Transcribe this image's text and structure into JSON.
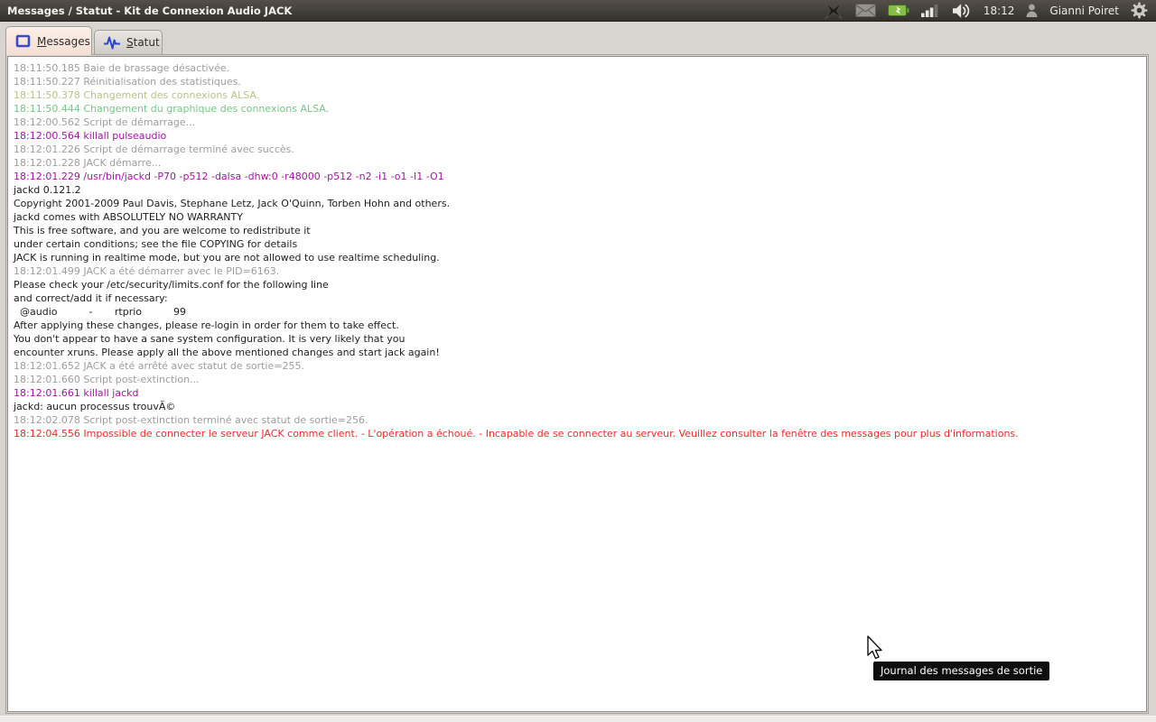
{
  "colors": {
    "gray": "#9d9d9d",
    "khaki": "#bcc088",
    "green": "#77c687",
    "magenta": "#a413a4",
    "black": "#1d1d1d",
    "red": "#ee2b2b"
  },
  "panel": {
    "title": "Messages / Statut - Kit de Connexion Audio JACK",
    "clock": "18:12",
    "user": "Gianni Poiret",
    "tray_icons": [
      "jack-tray-icon",
      "mail-icon",
      "battery-icon",
      "signal-strength-icon",
      "volume-icon",
      "user-icon",
      "settings-gear-icon"
    ]
  },
  "tabs": [
    {
      "label": "Messages"
    },
    {
      "label": "Statut"
    }
  ],
  "tooltip": {
    "text": "Journal des messages de sortie"
  },
  "log": {
    "lines": [
      {
        "color": "gray",
        "text": "18:11:50.185 Baie de brassage désactivée."
      },
      {
        "color": "gray",
        "text": "18:11:50.227 Réinitialisation des statistiques."
      },
      {
        "color": "khaki",
        "text": "18:11:50.378 Changement des connexions ALSA."
      },
      {
        "color": "green",
        "text": "18:11:50.444 Changement du graphique des connexions ALSA."
      },
      {
        "color": "gray",
        "text": "18:12:00.562 Script de démarrage..."
      },
      {
        "color": "magenta",
        "text": "18:12:00.564 killall pulseaudio"
      },
      {
        "color": "gray",
        "text": "18:12:01.226 Script de démarrage terminé avec succès."
      },
      {
        "color": "gray",
        "text": "18:12:01.228 JACK démarre..."
      },
      {
        "color": "magenta",
        "text": "18:12:01.229 /usr/bin/jackd -P70 -p512 -dalsa -dhw:0 -r48000 -p512 -n2 -i1 -o1 -I1 -O1"
      },
      {
        "color": "black",
        "text": "jackd 0.121.2"
      },
      {
        "color": "black",
        "text": "Copyright 2001-2009 Paul Davis, Stephane Letz, Jack O'Quinn, Torben Hohn and others."
      },
      {
        "color": "black",
        "text": "jackd comes with ABSOLUTELY NO WARRANTY"
      },
      {
        "color": "black",
        "text": "This is free software, and you are welcome to redistribute it"
      },
      {
        "color": "black",
        "text": "under certain conditions; see the file COPYING for details"
      },
      {
        "color": "black",
        "text": "JACK is running in realtime mode, but you are not allowed to use realtime scheduling."
      },
      {
        "color": "gray",
        "text": "18:12:01.499 JACK a été démarrer avec le PID=6163."
      },
      {
        "color": "black",
        "text": "Please check your /etc/security/limits.conf for the following line"
      },
      {
        "color": "black",
        "text": "and correct/add it if necessary:"
      },
      {
        "color": "black",
        "text": "  @audio          -       rtprio          99"
      },
      {
        "color": "black",
        "text": "After applying these changes, please re-login in order for them to take effect."
      },
      {
        "color": "black",
        "text": "You don't appear to have a sane system configuration. It is very likely that you"
      },
      {
        "color": "black",
        "text": "encounter xruns. Please apply all the above mentioned changes and start jack again!"
      },
      {
        "color": "gray",
        "text": "18:12:01.652 JACK a été arrêté avec statut de sortie=255."
      },
      {
        "color": "gray",
        "text": "18:12:01.660 Script post-extinction..."
      },
      {
        "color": "magenta",
        "text": "18:12:01.661 killall jackd"
      },
      {
        "color": "black",
        "text": "jackd: aucun processus trouvÃ©"
      },
      {
        "color": "gray",
        "text": "18:12:02.078 Script post-extinction terminé avec statut de sortie=256."
      },
      {
        "color": "red",
        "text": "18:12:04.556 Impossible de connecter le serveur JACK comme client. - L'opération a échoué. - Incapable de se connecter au serveur. Veuillez consulter la fenêtre des messages pour plus d'informations."
      }
    ]
  }
}
